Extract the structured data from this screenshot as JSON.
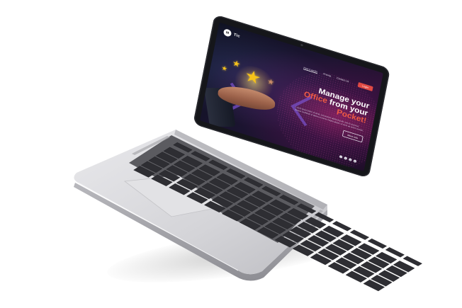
{
  "site": {
    "logo_mark": "M",
    "logo_text": "Tic"
  },
  "nav": {
    "items": [
      "How it works",
      "Pricing",
      "Contact Us"
    ],
    "login_label": "Login"
  },
  "hero": {
    "headline_line1": "Manage your",
    "headline_accent1": "Office",
    "headline_mid": " from your",
    "headline_accent2": "Pocket!",
    "subtext": "Lorem ipsum dolor sit amet, consectetur adipiscing elit, sed do eiusmod tempor incididunt ut labore et dolore magna aliqua. Ut enim ad minim veniam.",
    "cta_label": "More Info"
  },
  "social_icons": [
    "facebook-icon",
    "twitter-icon",
    "instagram-icon",
    "linkedin-icon"
  ],
  "colors": {
    "accent": "#ef5a44",
    "login_bg": "#e04a44",
    "star": "#f6c21a"
  }
}
